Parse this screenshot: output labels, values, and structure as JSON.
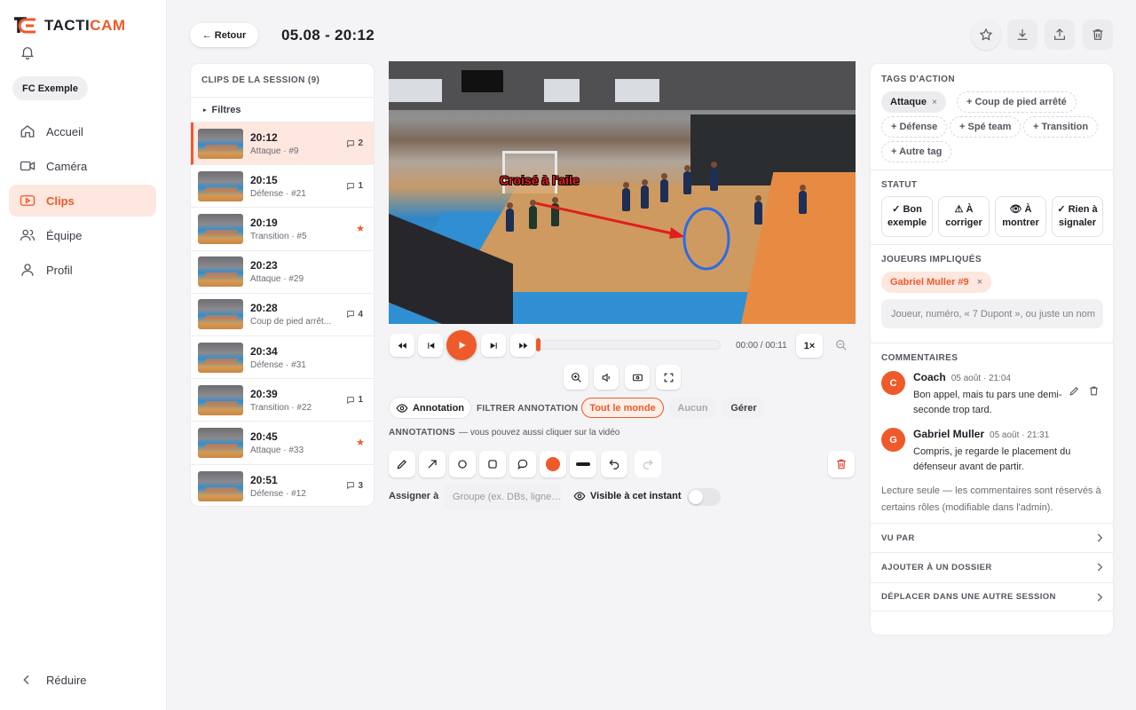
{
  "app": {
    "logo_text_a": "TACTI",
    "logo_text_b": "CAM",
    "team": "FC Exemple",
    "accent": "#ef5a2a"
  },
  "nav": {
    "items": [
      {
        "label": "Accueil",
        "icon": "home-icon"
      },
      {
        "label": "Caméra",
        "icon": "camera-icon"
      },
      {
        "label": "Clips",
        "icon": "clips-icon"
      },
      {
        "label": "Équipe",
        "icon": "team-icon"
      },
      {
        "label": "Profil",
        "icon": "profile-icon"
      }
    ],
    "active": "Clips",
    "collapse_label": "Réduire"
  },
  "header": {
    "back_label": "← Retour",
    "title": "05.08 - 20:12"
  },
  "clips": {
    "heading": "CLIPS DE LA SESSION (9)",
    "filters_label": "Filtres",
    "items": [
      {
        "time": "20:12",
        "sub": "Attaque · #9",
        "comments": "2"
      },
      {
        "time": "20:15",
        "sub": "Défense · #21",
        "comments": "1"
      },
      {
        "time": "20:19",
        "sub": "Transition · #5",
        "star": "★"
      },
      {
        "time": "20:23",
        "sub": "Attaque · #29"
      },
      {
        "time": "20:28",
        "sub": "Coup de pied arrêt...",
        "comments": "4"
      },
      {
        "time": "20:34",
        "sub": "Défense · #31"
      },
      {
        "time": "20:39",
        "sub": "Transition · #22",
        "comments": "1"
      },
      {
        "time": "20:45",
        "sub": "Attaque · #33",
        "star": "★"
      },
      {
        "time": "20:51",
        "sub": "Défense · #12",
        "comments": "3"
      }
    ]
  },
  "video": {
    "overlay_text": "Croisé à l'aile",
    "time": "00:00 / 00:11",
    "speed": "1×",
    "progress": 0
  },
  "annotation": {
    "toggle_label": "Annotation",
    "filter_label": "FILTRER ANNOTATION",
    "filter_options": [
      "Tout le monde",
      "Aucun",
      "Gérer"
    ],
    "filter_selected": "Tout le monde",
    "section_label": "ANNOTATIONS",
    "hint": "— vous pouvez aussi cliquer sur la vidéo",
    "assign_label": "Assigner à",
    "assign_placeholder": "Groupe (ex. DBs, ligne…",
    "visible_label": "Visible à cet instant",
    "color": "#ef5a2a"
  },
  "tags": {
    "heading": "TAGS D'ACTION",
    "active": "Attaque",
    "remove": "×",
    "options": [
      "+ Coup de pied arrêté",
      "+ Défense",
      "+ Spé team",
      "+ Transition",
      "+ Autre tag"
    ]
  },
  "status": {
    "heading": "STATUT",
    "options": [
      {
        "line1": "✓ Bon",
        "line2": "exemple"
      },
      {
        "line1": "⚠ À",
        "line2": "corriger"
      },
      {
        "line1": "👁 À",
        "line2": "montrer"
      },
      {
        "line1": "✓ Rien à",
        "line2": "signaler"
      }
    ]
  },
  "players": {
    "heading": "JOUEURS IMPLIQUÉS",
    "selected": "Gabriel Muller #9",
    "remove": "×",
    "placeholder": "Joueur, numéro, « 7 Dupont », ou juste un nom"
  },
  "comments": {
    "heading": "COMMENTAIRES",
    "items": [
      {
        "initial": "C",
        "author": "Coach",
        "date": "05 août · 21:04",
        "body": "Bon appel, mais tu pars une demi-seconde trop tard."
      },
      {
        "initial": "G",
        "author": "Gabriel Muller",
        "date": "05 août · 21:31",
        "body": "Compris, je regarde le placement du défenseur avant de partir."
      }
    ],
    "readonly_note": "Lecture seule — les commentaires sont réservés à certains rôles (modifiable dans l'admin)."
  },
  "accordion": [
    "VU PAR",
    "AJOUTER À UN DOSSIER",
    "DÉPLACER DANS UNE AUTRE SESSION"
  ]
}
